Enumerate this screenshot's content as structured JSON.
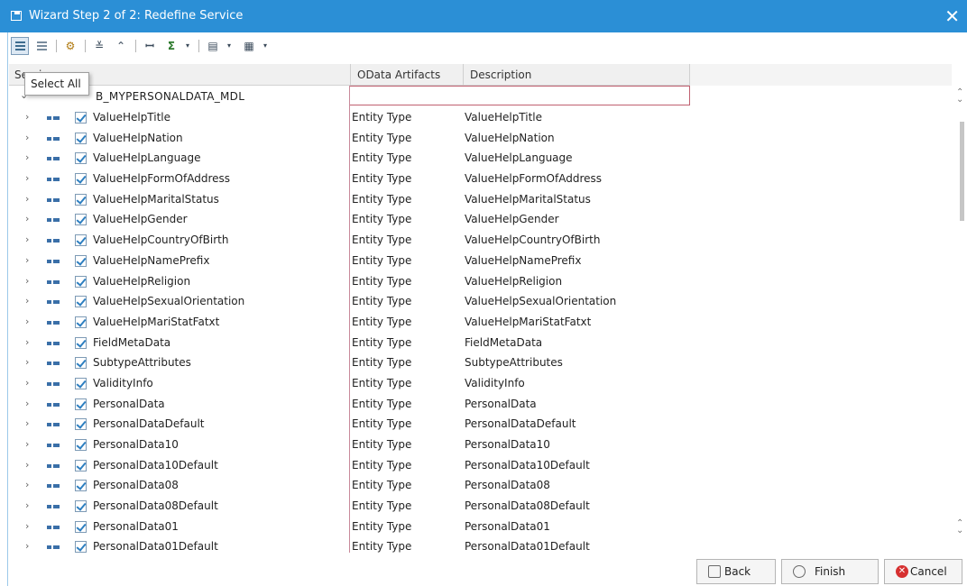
{
  "window": {
    "title": "Wizard Step 2 of 2: Redefine Service",
    "close_glyph": "✕"
  },
  "toolbar": {
    "tooltip": "Select All",
    "sum_glyph": "Σ",
    "icons": [
      "select-all-icon",
      "deselect-all-icon",
      "settings-icon",
      "expand-all-icon",
      "collapse-all-icon",
      "find-icon",
      "sum-icon",
      "print-icon",
      "layout-icon"
    ]
  },
  "table": {
    "headers": {
      "col1": "Service",
      "col2": "OData Artifacts",
      "col3": "Description"
    },
    "root": {
      "name": "B_MYPERSONALDATA_MDL"
    },
    "rows": [
      {
        "name": "ValueHelpTitle",
        "type": "Entity Type",
        "desc": "ValueHelpTitle"
      },
      {
        "name": "ValueHelpNation",
        "type": "Entity Type",
        "desc": "ValueHelpNation"
      },
      {
        "name": "ValueHelpLanguage",
        "type": "Entity Type",
        "desc": "ValueHelpLanguage"
      },
      {
        "name": "ValueHelpFormOfAddress",
        "type": "Entity Type",
        "desc": "ValueHelpFormOfAddress"
      },
      {
        "name": "ValueHelpMaritalStatus",
        "type": "Entity Type",
        "desc": "ValueHelpMaritalStatus"
      },
      {
        "name": "ValueHelpGender",
        "type": "Entity Type",
        "desc": "ValueHelpGender"
      },
      {
        "name": "ValueHelpCountryOfBirth",
        "type": "Entity Type",
        "desc": "ValueHelpCountryOfBirth"
      },
      {
        "name": "ValueHelpNamePrefix",
        "type": "Entity Type",
        "desc": "ValueHelpNamePrefix"
      },
      {
        "name": "ValueHelpReligion",
        "type": "Entity Type",
        "desc": "ValueHelpReligion"
      },
      {
        "name": "ValueHelpSexualOrientation",
        "type": "Entity Type",
        "desc": "ValueHelpSexualOrientation"
      },
      {
        "name": "ValueHelpMariStatFatxt",
        "type": "Entity Type",
        "desc": "ValueHelpMariStatFatxt"
      },
      {
        "name": "FieldMetaData",
        "type": "Entity Type",
        "desc": "FieldMetaData"
      },
      {
        "name": "SubtypeAttributes",
        "type": "Entity Type",
        "desc": "SubtypeAttributes"
      },
      {
        "name": "ValidityInfo",
        "type": "Entity Type",
        "desc": "ValidityInfo"
      },
      {
        "name": "PersonalData",
        "type": "Entity Type",
        "desc": "PersonalData"
      },
      {
        "name": "PersonalDataDefault",
        "type": "Entity Type",
        "desc": "PersonalDataDefault"
      },
      {
        "name": "PersonalData10",
        "type": "Entity Type",
        "desc": "PersonalData10"
      },
      {
        "name": "PersonalData10Default",
        "type": "Entity Type",
        "desc": "PersonalData10Default"
      },
      {
        "name": "PersonalData08",
        "type": "Entity Type",
        "desc": "PersonalData08"
      },
      {
        "name": "PersonalData08Default",
        "type": "Entity Type",
        "desc": "PersonalData08Default"
      },
      {
        "name": "PersonalData01",
        "type": "Entity Type",
        "desc": "PersonalData01"
      },
      {
        "name": "PersonalData01Default",
        "type": "Entity Type",
        "desc": "PersonalData01Default"
      }
    ]
  },
  "buttons": {
    "back": "Back",
    "finish": "Finish",
    "cancel": "Cancel"
  },
  "colors": {
    "titlebar": "#2b8fd6",
    "check": "#2d7fc1",
    "root_border": "#c06070",
    "cancel_icon": "#d63030"
  }
}
